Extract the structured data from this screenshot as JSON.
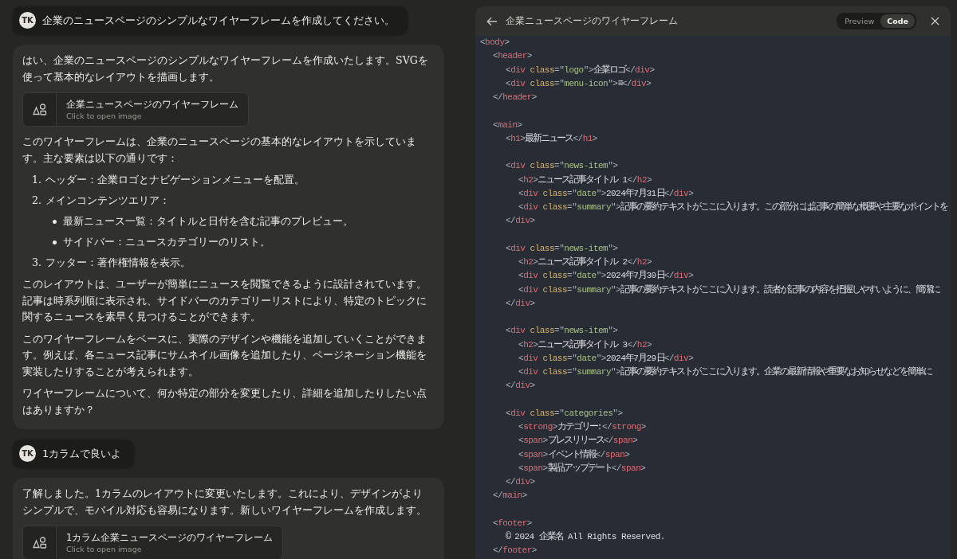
{
  "chat": [
    {
      "kind": "user",
      "avatar": "TK",
      "text": "企業のニュースページのシンプルなワイヤーフレームを作成してください。"
    },
    {
      "kind": "assistant",
      "blocks": [
        {
          "kind": "p",
          "text": "はい、企業のニュースページのシンプルなワイヤーフレームを作成いたします。SVGを使って基本的なレイアウトを描画します。"
        },
        {
          "kind": "artifact",
          "title": "企業ニュースページのワイヤーフレーム",
          "subtitle": "Click to open image"
        },
        {
          "kind": "p",
          "text": "このワイヤーフレームは、企業のニュースページの基本的なレイアウトを示しています。主な要素は以下の通りです："
        },
        {
          "kind": "ol",
          "items": [
            {
              "marker": "1.",
              "text": "ヘッダー：企業ロゴとナビゲーションメニューを配置。"
            },
            {
              "marker": "2.",
              "text": "メインコンテンツエリア：",
              "children": [
                {
                  "text": "最新ニュース一覧：タイトルと日付を含む記事のプレビュー。"
                },
                {
                  "text": "サイドバー：ニュースカテゴリーのリスト。"
                }
              ]
            },
            {
              "marker": "3.",
              "text": "フッター：著作権情報を表示。"
            }
          ]
        },
        {
          "kind": "p",
          "text": "このレイアウトは、ユーザーが簡単にニュースを閲覧できるように設計されています。記事は時系列順に表示され、サイドバーのカテゴリーリストにより、特定のトピックに関するニュースを素早く見つけることができます。"
        },
        {
          "kind": "p",
          "text": "このワイヤーフレームをベースに、実際のデザインや機能を追加していくことができます。例えば、各ニュース記事にサムネイル画像を追加したり、ページネーション機能を実装したりすることが考えられます。"
        },
        {
          "kind": "p",
          "text": "ワイヤーフレームについて、何か特定の部分を変更したり、詳細を追加したりしたい点はありますか？"
        }
      ]
    },
    {
      "kind": "user",
      "avatar": "TK",
      "text": "1カラムで良いよ"
    },
    {
      "kind": "assistant",
      "blocks": [
        {
          "kind": "p",
          "text": "了解しました。1カラムのレイアウトに変更いたします。これにより、デザインがよりシンプルで、モバイル対応も容易になります。新しいワイヤーフレームを作成します。"
        },
        {
          "kind": "artifact",
          "title": "1カラム企業ニュースページのワイヤーフレーム",
          "subtitle": "Click to open image"
        }
      ]
    }
  ],
  "artifact_panel": {
    "title": "企業ニュースページのワイヤーフレーム",
    "tabs": [
      {
        "label": "Preview",
        "selected": false
      },
      {
        "label": "Code",
        "selected": true
      }
    ],
    "code_lines": [
      {
        "kind": "code",
        "text": "<body>"
      },
      {
        "kind": "code",
        "text": "    <header>"
      },
      {
        "kind": "code",
        "text": "        <div class=\"logo\">企業ロゴ</div>"
      },
      {
        "kind": "code",
        "text": "        <div class=\"menu-icon\">≡</div>"
      },
      {
        "kind": "code",
        "text": "    </header>"
      },
      {
        "kind": "blank"
      },
      {
        "kind": "code",
        "text": "    <main>"
      },
      {
        "kind": "code",
        "text": "        <h1>最新ニュース</h1>"
      },
      {
        "kind": "blank"
      },
      {
        "kind": "code",
        "text": "        <div class=\"news-item\">"
      },
      {
        "kind": "code",
        "text": "            <h2>ニュース記事タイトル 1</h2>"
      },
      {
        "kind": "code",
        "text": "            <div class=\"date\">2024年7月31日</div>"
      },
      {
        "kind": "code",
        "text": "            <div class=\"summary\">記事の要約テキストがここに入ります。この部分には記事の簡単な概要や主要なポイントを"
      },
      {
        "kind": "code",
        "text": "        </div>"
      },
      {
        "kind": "blank"
      },
      {
        "kind": "code",
        "text": "        <div class=\"news-item\">"
      },
      {
        "kind": "code",
        "text": "            <h2>ニュース記事タイトル 2</h2>"
      },
      {
        "kind": "code",
        "text": "            <div class=\"date\">2024年7月30日</div>"
      },
      {
        "kind": "code",
        "text": "            <div class=\"summary\">記事の要約テキストがここに入ります。読者が記事の内容を把握しやすいように、簡潔に"
      },
      {
        "kind": "code",
        "text": "        </div>"
      },
      {
        "kind": "blank"
      },
      {
        "kind": "code",
        "text": "        <div class=\"news-item\">"
      },
      {
        "kind": "code",
        "text": "            <h2>ニュース記事タイトル 3</h2>"
      },
      {
        "kind": "code",
        "text": "            <div class=\"date\">2024年7月29日</div>"
      },
      {
        "kind": "code",
        "text": "            <div class=\"summary\">記事の要約テキストがここに入ります。企業の最新情報や重要なお知らせなどを簡単に"
      },
      {
        "kind": "code",
        "text": "        </div>"
      },
      {
        "kind": "blank"
      },
      {
        "kind": "code",
        "text": "        <div class=\"categories\">"
      },
      {
        "kind": "code",
        "text": "            <strong>カテゴリー:</strong>"
      },
      {
        "kind": "code",
        "text": "            <span>プレスリリース</span>"
      },
      {
        "kind": "code",
        "text": "            <span>イベント情報</span>"
      },
      {
        "kind": "code",
        "text": "            <span>製品アップデート</span>"
      },
      {
        "kind": "code",
        "text": "        </div>"
      },
      {
        "kind": "code",
        "text": "    </main>"
      },
      {
        "kind": "blank"
      },
      {
        "kind": "code",
        "text": "    <footer>"
      },
      {
        "kind": "code",
        "text": "        © 2024 企業名 All Rights Reserved."
      },
      {
        "kind": "code",
        "text": "    </footer>"
      }
    ]
  }
}
